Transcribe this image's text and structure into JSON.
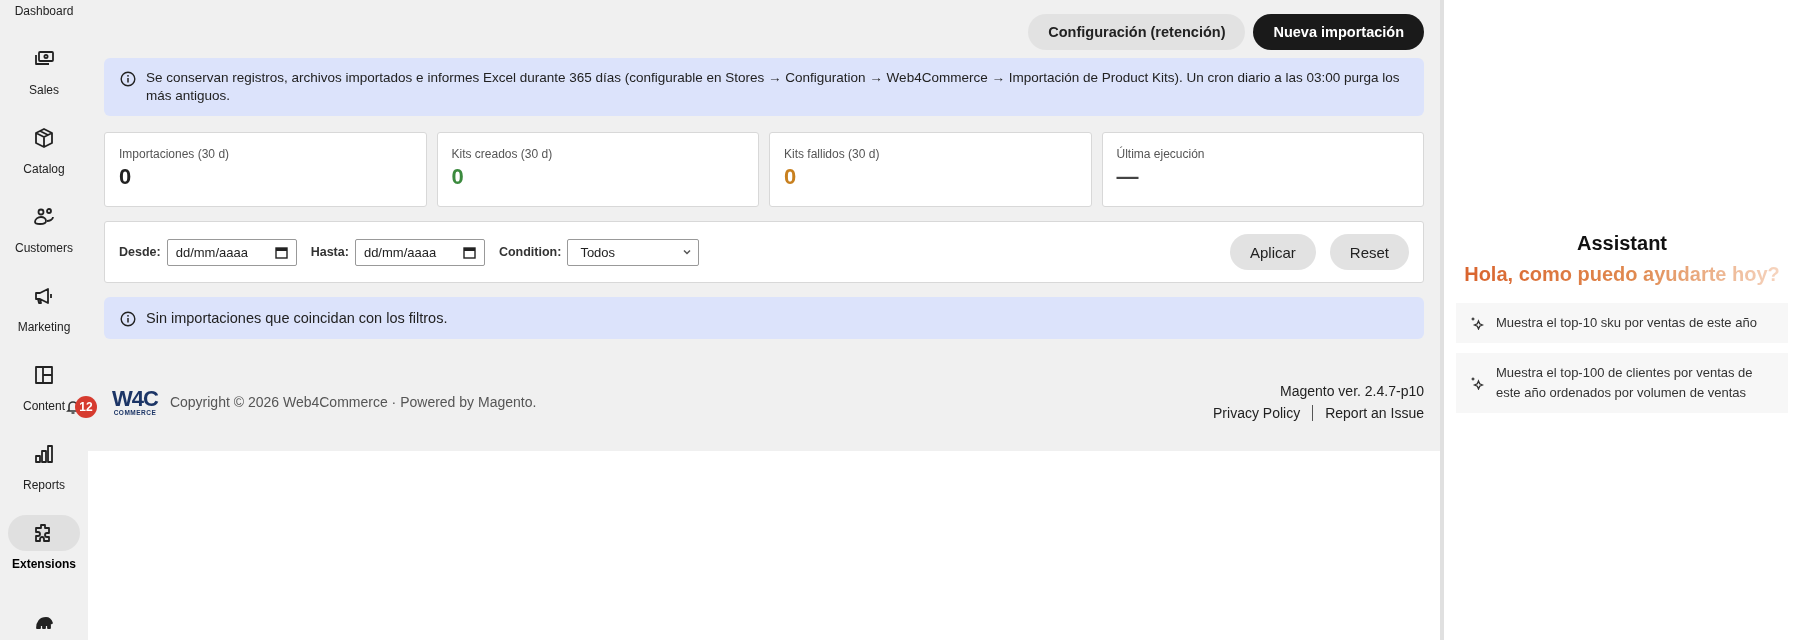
{
  "sidebar": {
    "items": [
      {
        "label": "Dashboard",
        "selected": false
      },
      {
        "label": "Sales",
        "selected": false
      },
      {
        "label": "Catalog",
        "selected": false
      },
      {
        "label": "Customers",
        "selected": false
      },
      {
        "label": "Marketing",
        "selected": false
      },
      {
        "label": "Content",
        "selected": false
      },
      {
        "label": "Reports",
        "selected": false
      },
      {
        "label": "Extensions",
        "selected": true
      },
      {
        "selected": false
      }
    ],
    "notification_count": "12"
  },
  "header": {
    "buttons": [
      {
        "label": "Configuración (retención)",
        "kind": "secondary"
      },
      {
        "label": "Nueva importación",
        "kind": "primary"
      }
    ]
  },
  "retention_notice": "Se conservan registros, archivos importados e informes Excel durante 365 días (configurable en Stores → Configuration → Web4Commerce → Importación de Product Kits). Un cron diario a las 03:00 purga los más antiguos.",
  "stats": [
    {
      "label": "Importaciones (30 d)",
      "value": "0",
      "color": "#222222"
    },
    {
      "label": "Kits creados (30 d)",
      "value": "0",
      "color": "#3b8a3e"
    },
    {
      "label": "Kits fallidos (30 d)",
      "value": "0",
      "color": "#c8801f"
    },
    {
      "label": "Última ejecución",
      "value": "—",
      "color": "#444444"
    }
  ],
  "filters": {
    "fields": [
      {
        "label": "Desde:",
        "kind": "date",
        "placeholder": "dd/mm/aaaa"
      },
      {
        "label": "Hasta:",
        "kind": "date",
        "placeholder": "dd/mm/aaaa"
      },
      {
        "label": "Condition:",
        "kind": "select",
        "value": "Todos"
      }
    ],
    "buttons": [
      "Aplicar",
      "Reset"
    ]
  },
  "empty_notice": "Sin importaciones que coincidan con los filtros.",
  "footer": {
    "logo": {
      "mark": "W4C",
      "sub": "COMMERCE"
    },
    "copyright": "Copyright © 2026 Web4Commerce · Powered by Magento.",
    "version": "Magento ver. 2.4.7-p10",
    "links": [
      "Privacy Policy",
      "Report an Issue"
    ]
  },
  "assistant": {
    "title": "Assistant",
    "greeting": "Hola, como puedo ayudarte hoy?",
    "suggestions": [
      "Muestra el top-10 sku por ventas de este año",
      "Muestra el top-100 de clientes por ventas de este año ordenados por volumen de ventas"
    ]
  }
}
